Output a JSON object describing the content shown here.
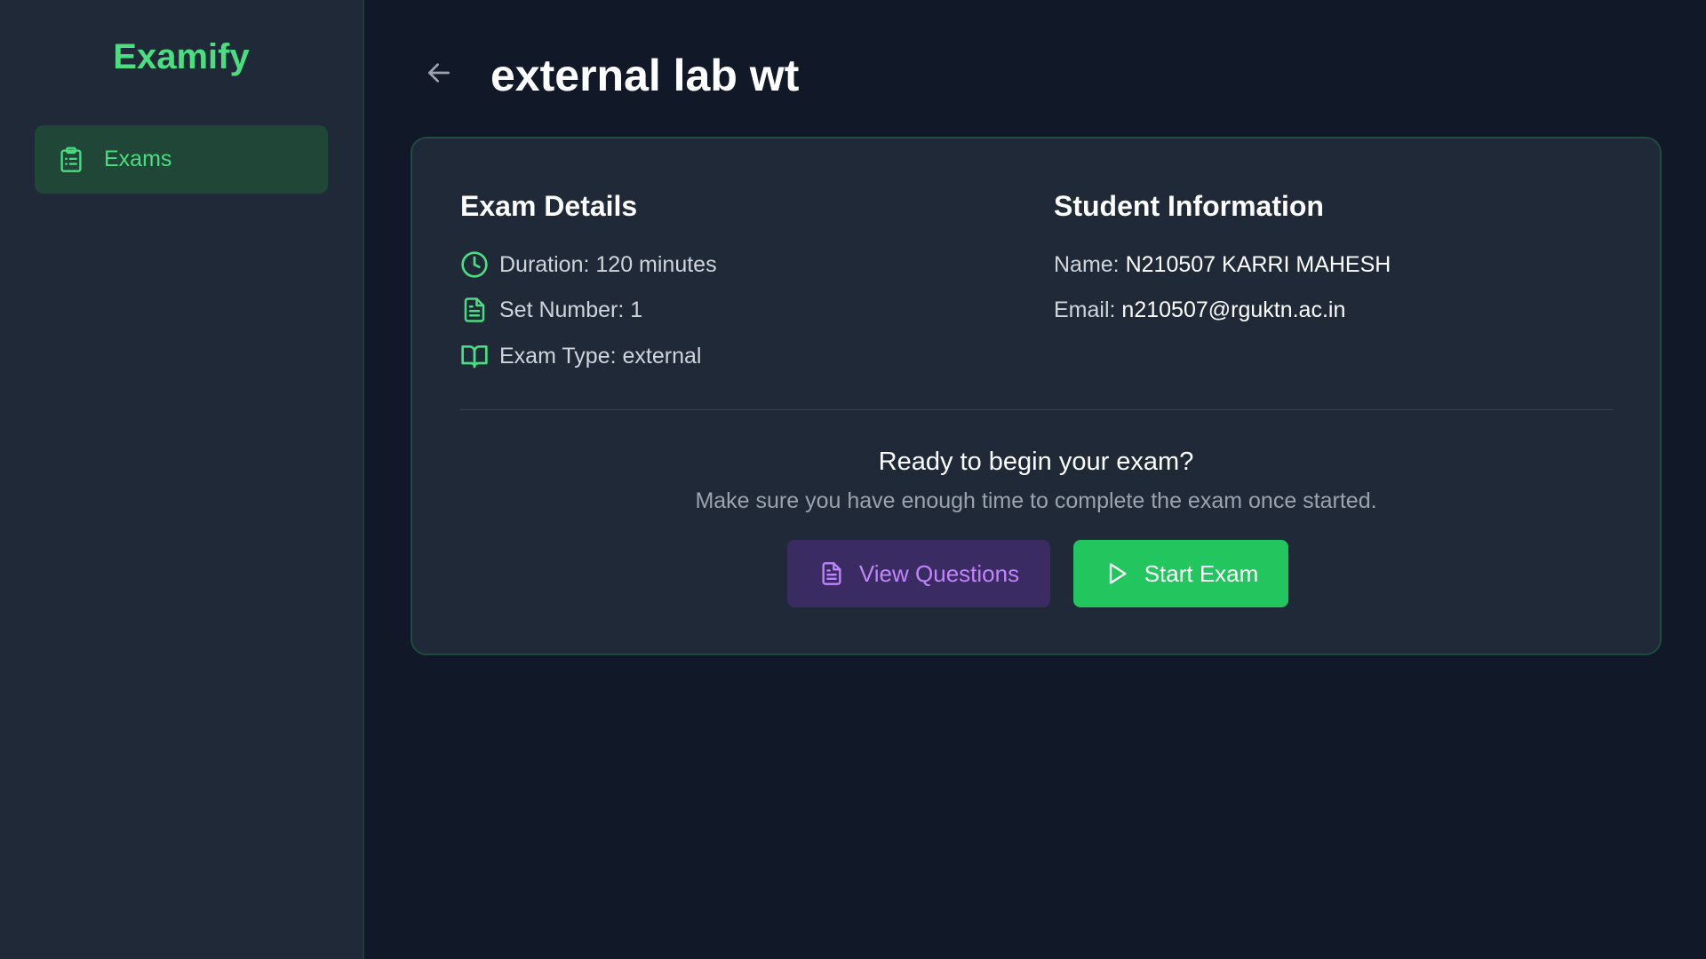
{
  "app": {
    "brand": "Examify",
    "accent_color": "#4ade80"
  },
  "sidebar": {
    "items": [
      {
        "label": "Exams",
        "icon": "clipboard-icon",
        "active": true
      }
    ]
  },
  "header": {
    "back_icon": "arrow-left-icon",
    "title": "external lab wt"
  },
  "exam_details": {
    "title": "Exam Details",
    "rows": [
      {
        "icon": "clock-icon",
        "text": "Duration: 120 minutes"
      },
      {
        "icon": "file-text-icon",
        "text": "Set Number: 1"
      },
      {
        "icon": "book-open-icon",
        "text": "Exam Type: external"
      }
    ]
  },
  "student_info": {
    "title": "Student Information",
    "name_label": "Name:",
    "name_value": "N210507 KARRI MAHESH",
    "email_label": "Email:",
    "email_value": "n210507@rguktn.ac.in"
  },
  "start_section": {
    "heading": "Ready to begin your exam?",
    "subtext": "Make sure you have enough time to complete the exam once started.",
    "view_button": {
      "label": "View Questions",
      "icon": "file-text-icon",
      "color": "#c084fc"
    },
    "start_button": {
      "label": "Start Exam",
      "icon": "play-icon",
      "color": "#22c55e"
    }
  }
}
